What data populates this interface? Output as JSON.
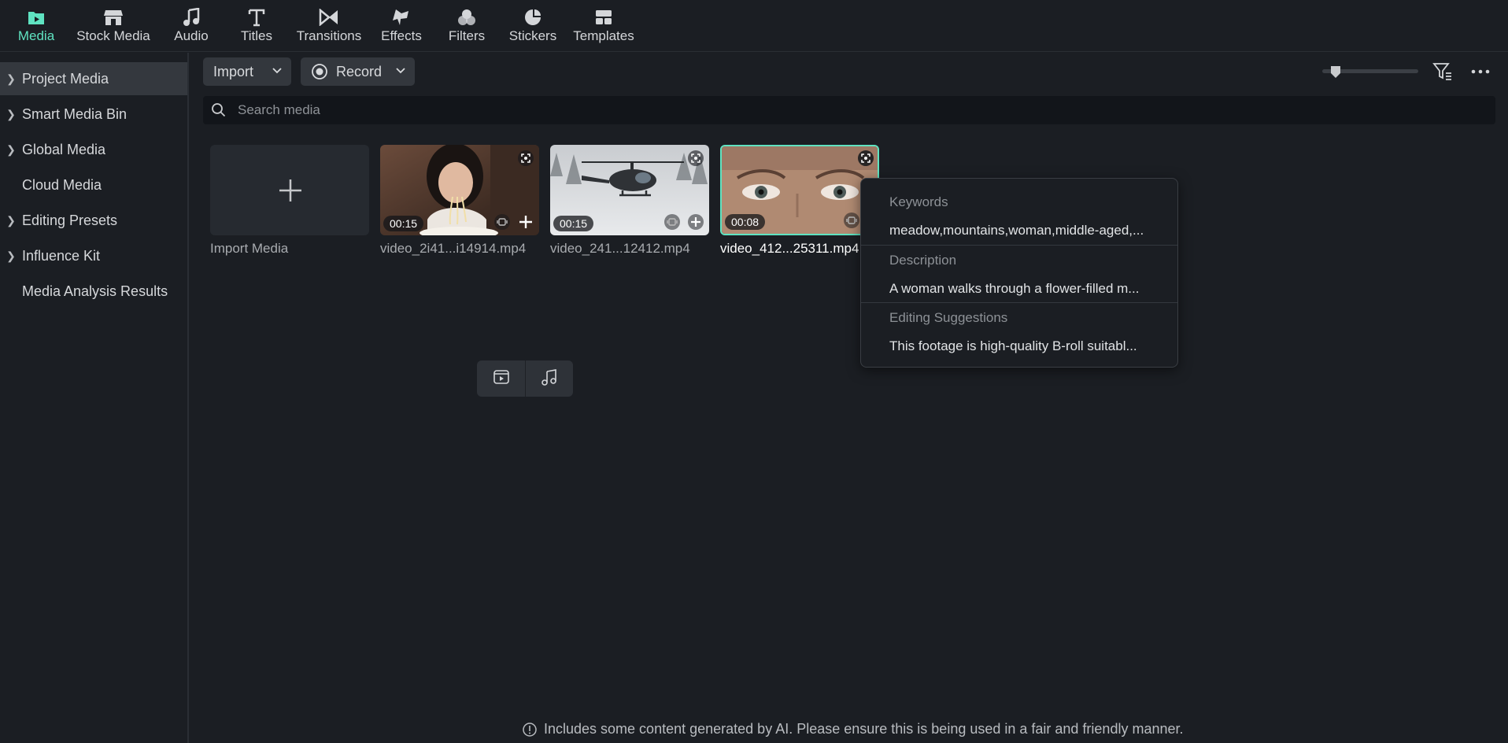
{
  "toolbar": {
    "tabs": [
      {
        "label": "Media",
        "icon": "media-icon",
        "active": true
      },
      {
        "label": "Stock Media",
        "icon": "store-icon"
      },
      {
        "label": "Audio",
        "icon": "music-note-icon"
      },
      {
        "label": "Titles",
        "icon": "text-icon"
      },
      {
        "label": "Transitions",
        "icon": "transition-icon"
      },
      {
        "label": "Effects",
        "icon": "effects-icon"
      },
      {
        "label": "Filters",
        "icon": "filters-icon"
      },
      {
        "label": "Stickers",
        "icon": "sticker-icon"
      },
      {
        "label": "Templates",
        "icon": "templates-icon"
      }
    ]
  },
  "sidebar": {
    "items": [
      {
        "label": "Project Media",
        "expandable": true,
        "active": true
      },
      {
        "label": "Smart Media Bin",
        "expandable": true
      },
      {
        "label": "Global Media",
        "expandable": true
      },
      {
        "label": "Cloud Media",
        "expandable": false
      },
      {
        "label": "Editing Presets",
        "expandable": true
      },
      {
        "label": "Influence Kit",
        "expandable": true
      },
      {
        "label": "Media Analysis Results",
        "expandable": false
      }
    ]
  },
  "actions": {
    "import_label": "Import",
    "record_label": "Record"
  },
  "search": {
    "placeholder": "Search media"
  },
  "media": {
    "import_label": "Import Media",
    "items": [
      {
        "name": "video_2i41...i14914.mp4",
        "duration": "00:15"
      },
      {
        "name": "video_241...12412.mp4",
        "duration": "00:15"
      },
      {
        "name": "video_412...25311.mp4",
        "duration": "00:08",
        "selected": true
      }
    ]
  },
  "popup": {
    "keywords_label": "Keywords",
    "keywords_value": "meadow,mountains,woman,middle-aged,...",
    "description_label": "Description",
    "description_value": "A woman walks through a flower-filled m...",
    "suggestions_label": "Editing Suggestions",
    "suggestions_value": "This footage is high-quality B-roll suitabl..."
  },
  "footer": {
    "notice": "Includes some content generated by AI. Please ensure this is being used in a fair and friendly manner."
  },
  "colors": {
    "accent": "#5fe3c1",
    "background": "#1b1e23"
  }
}
